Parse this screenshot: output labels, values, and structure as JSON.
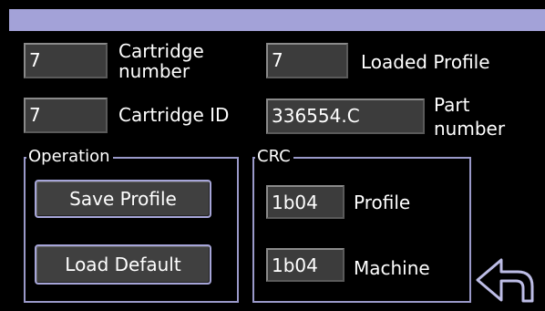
{
  "header": {
    "title": ""
  },
  "cartridge": {
    "number_label": "Cartridge\nnumber",
    "number_value": "7",
    "id_label": "Cartridge ID",
    "id_value": "7"
  },
  "profile": {
    "loaded_label": "Loaded Profile",
    "loaded_value": "7",
    "part_label": "Part\nnumber",
    "part_value": "336554.C"
  },
  "operation": {
    "title": "Operation",
    "save_label": "Save Profile",
    "load_label": "Load Default"
  },
  "crc": {
    "title": "CRC",
    "profile_label": "Profile",
    "profile_value": "1b04",
    "machine_label": "Machine",
    "machine_value": "1b04"
  },
  "icons": {
    "back": "back-arrow-icon"
  },
  "colors": {
    "background": "#000000",
    "titlebar": "#a3a2d8",
    "accent_border": "#9a99c9",
    "field_bg": "#3c3c3c",
    "text": "#ffffff"
  }
}
